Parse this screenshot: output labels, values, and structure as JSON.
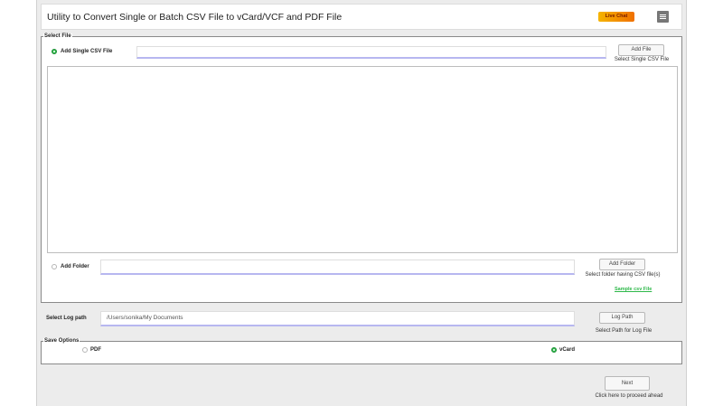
{
  "app": {
    "title": "Utility to Convert Single or Batch CSV File to vCard/VCF and PDF File",
    "live_badge": "Live Chat",
    "menu_icon": "hamburger-menu-icon"
  },
  "select_file": {
    "legend": "Select File",
    "single_option_label": "Add Single CSV File",
    "single_option_selected": true,
    "single_file_path": "",
    "add_file_button": "Add File",
    "add_file_hint": "Select Single CSV File",
    "folder_option_label": "Add Folder",
    "folder_option_selected": false,
    "folder_path": "",
    "add_folder_button": "Add Folder",
    "add_folder_hint": "Select folder having CSV file(s)",
    "sample_link": "Sample csv File"
  },
  "log": {
    "label": "Select Log path",
    "path": "/Users/sonika/My Documents",
    "button": "Log Path",
    "hint": "Select Path for Log File"
  },
  "save_options": {
    "legend": "Save Options",
    "pdf_label": "PDF",
    "pdf_selected": false,
    "vcard_label": "vCard",
    "vcard_selected": true
  },
  "footer": {
    "next_button": "Next",
    "next_hint": "Click here to proceed ahead"
  },
  "colors": {
    "accent_green": "#2eb84a",
    "badge_orange": "#f07000",
    "field_underline": "#b7b7f0"
  }
}
